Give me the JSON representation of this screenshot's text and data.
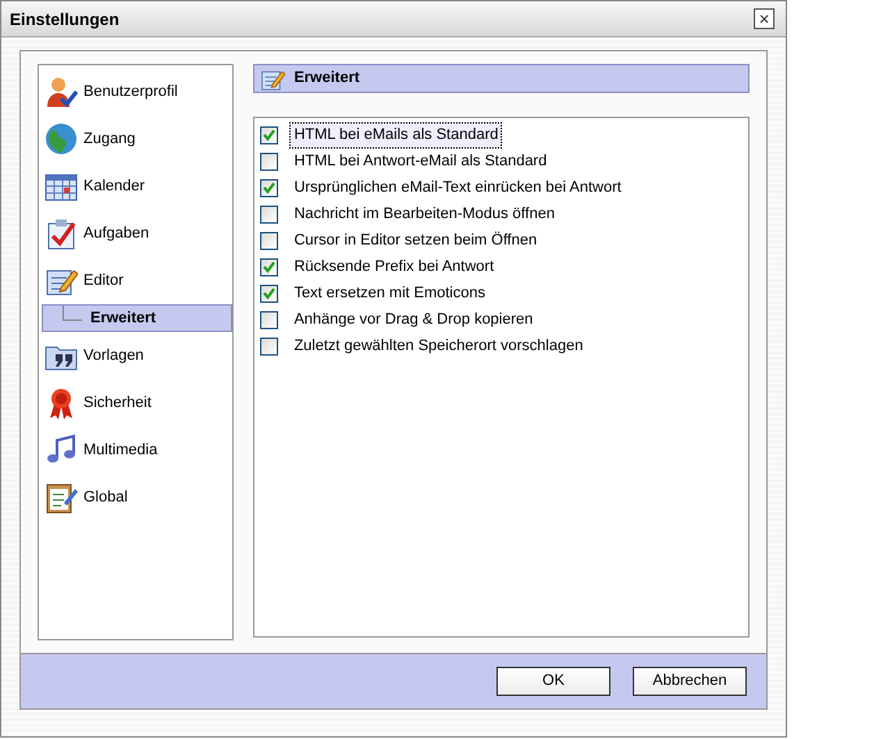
{
  "window": {
    "title": "Einstellungen",
    "close": "×"
  },
  "sidebar": {
    "items": [
      {
        "label": "Benutzerprofil",
        "kind": "user",
        "selected": false
      },
      {
        "label": "Zugang",
        "kind": "globe",
        "selected": false
      },
      {
        "label": "Kalender",
        "kind": "calendar",
        "selected": false
      },
      {
        "label": "Aufgaben",
        "kind": "tasks",
        "selected": false
      },
      {
        "label": "Editor",
        "kind": "editor",
        "selected": false,
        "children": [
          {
            "label": "Erweitert",
            "selected": true
          }
        ]
      },
      {
        "label": "Vorlagen",
        "kind": "quote",
        "selected": false
      },
      {
        "label": "Sicherheit",
        "kind": "ribbon",
        "selected": false
      },
      {
        "label": "Multimedia",
        "kind": "music",
        "selected": false
      },
      {
        "label": "Global",
        "kind": "clipboard",
        "selected": false
      }
    ]
  },
  "panel": {
    "title": "Erweitert",
    "options": [
      {
        "label": "HTML bei eMails als Standard",
        "checked": true,
        "focused": true
      },
      {
        "label": "HTML bei Antwort-eMail als Standard",
        "checked": false,
        "focused": false
      },
      {
        "label": "Ursprünglichen eMail-Text einrücken bei Antwort",
        "checked": true,
        "focused": false
      },
      {
        "label": "Nachricht im Bearbeiten-Modus öffnen",
        "checked": false,
        "focused": false
      },
      {
        "label": "Cursor in Editor setzen beim Öffnen",
        "checked": false,
        "focused": false
      },
      {
        "label": "Rücksende Prefix bei Antwort",
        "checked": true,
        "focused": false
      },
      {
        "label": "Text ersetzen mit Emoticons",
        "checked": true,
        "focused": false
      },
      {
        "label": "Anhänge vor Drag & Drop kopieren",
        "checked": false,
        "focused": false
      },
      {
        "label": "Zuletzt gewählten Speicherort vorschlagen",
        "checked": false,
        "focused": false
      }
    ]
  },
  "buttons": [
    "OK",
    "Abbrechen"
  ]
}
